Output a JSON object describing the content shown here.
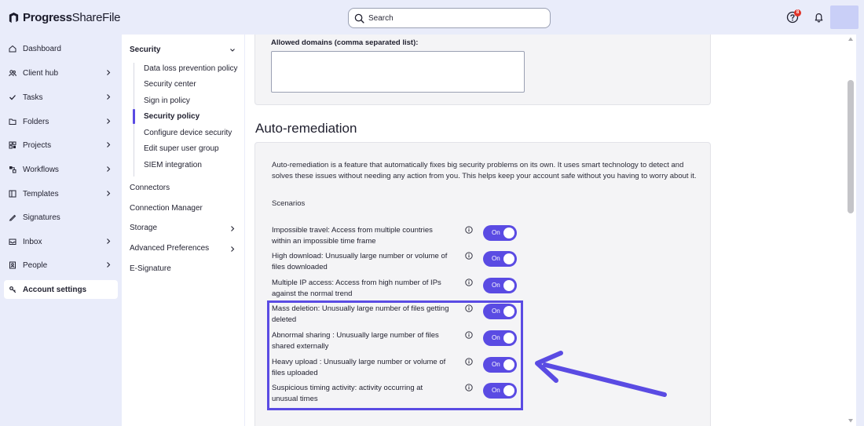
{
  "brand": {
    "name_bold": "Progress",
    "name_light": "ShareFile"
  },
  "search": {
    "placeholder": "Search"
  },
  "header": {
    "help_badge_count": "8",
    "icons": [
      "help-icon",
      "bell-icon"
    ]
  },
  "sidebar": {
    "items": [
      {
        "label": "Dashboard",
        "icon": "home-icon"
      },
      {
        "label": "Client hub",
        "icon": "users-icon"
      },
      {
        "label": "Tasks",
        "icon": "check-icon"
      },
      {
        "label": "Folders",
        "icon": "folder-icon"
      },
      {
        "label": "Projects",
        "icon": "projects-icon"
      },
      {
        "label": "Workflows",
        "icon": "workflow-icon"
      },
      {
        "label": "Templates",
        "icon": "template-icon"
      },
      {
        "label": "Signatures",
        "icon": "signature-icon"
      },
      {
        "label": "Inbox",
        "icon": "inbox-icon"
      },
      {
        "label": "People",
        "icon": "people-icon"
      },
      {
        "label": "Account settings",
        "icon": "settings-icon"
      }
    ]
  },
  "subnav": {
    "section": "Security",
    "children": [
      "Data loss prevention policy",
      "Security center",
      "Sign in policy",
      "Security policy",
      "Configure device security",
      "Edit super user group",
      "SIEM integration"
    ],
    "items": [
      "Connectors",
      "Connection Manager",
      "Storage",
      "Advanced Preferences",
      "E-Signature"
    ]
  },
  "main": {
    "allowed_domains_label": "Allowed domains (comma separated list):",
    "allowed_domains_value": "",
    "section_title": "Auto-remediation",
    "description": "Auto-remediation is a feature that automatically fixes big security problems on its own. It uses smart technology to detect and solves these issues without needing any action from you. This helps keep your account safe without you having to worry about it.",
    "scenarios_label": "Scenarios",
    "scenarios": [
      {
        "text": "Impossible travel: Access from multiple countries within an impossible time frame",
        "toggle": "On"
      },
      {
        "text": "High download: Unusually large number or volume of files downloaded",
        "toggle": "On"
      },
      {
        "text": "Multiple IP access: Access from high number of IPs against the normal trend",
        "toggle": "On"
      },
      {
        "text": "Mass deletion: Unusually large number of files getting deleted",
        "toggle": "On"
      },
      {
        "text": "Abnormal sharing : Unusually large number of files shared externally",
        "toggle": "On"
      },
      {
        "text": "Heavy upload : Unusually large number or volume of files uploaded",
        "toggle": "On"
      },
      {
        "text": "Suspicious timing activity: activity occurring at unusual times",
        "toggle": "On"
      }
    ]
  },
  "colors": {
    "accent": "#5a4be3",
    "background": "#e9ecfa",
    "panel": "#f4f4f6"
  }
}
